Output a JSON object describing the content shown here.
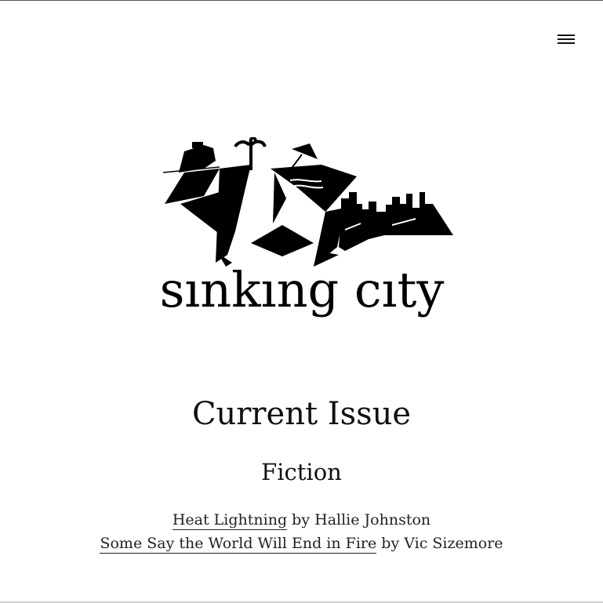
{
  "header": {
    "menu_icon": "hamburger-menu-icon"
  },
  "logo": {
    "wordmark": "sınkıng cıty"
  },
  "issue": {
    "title": "Current Issue",
    "section": "Fiction",
    "stories": [
      {
        "title": "Heat Lightning",
        "by": "by",
        "author": "Hallie Johnston"
      },
      {
        "title": "Some Say the World Will End in Fire",
        "by": "by",
        "author": "Vic Sizemore"
      }
    ]
  }
}
